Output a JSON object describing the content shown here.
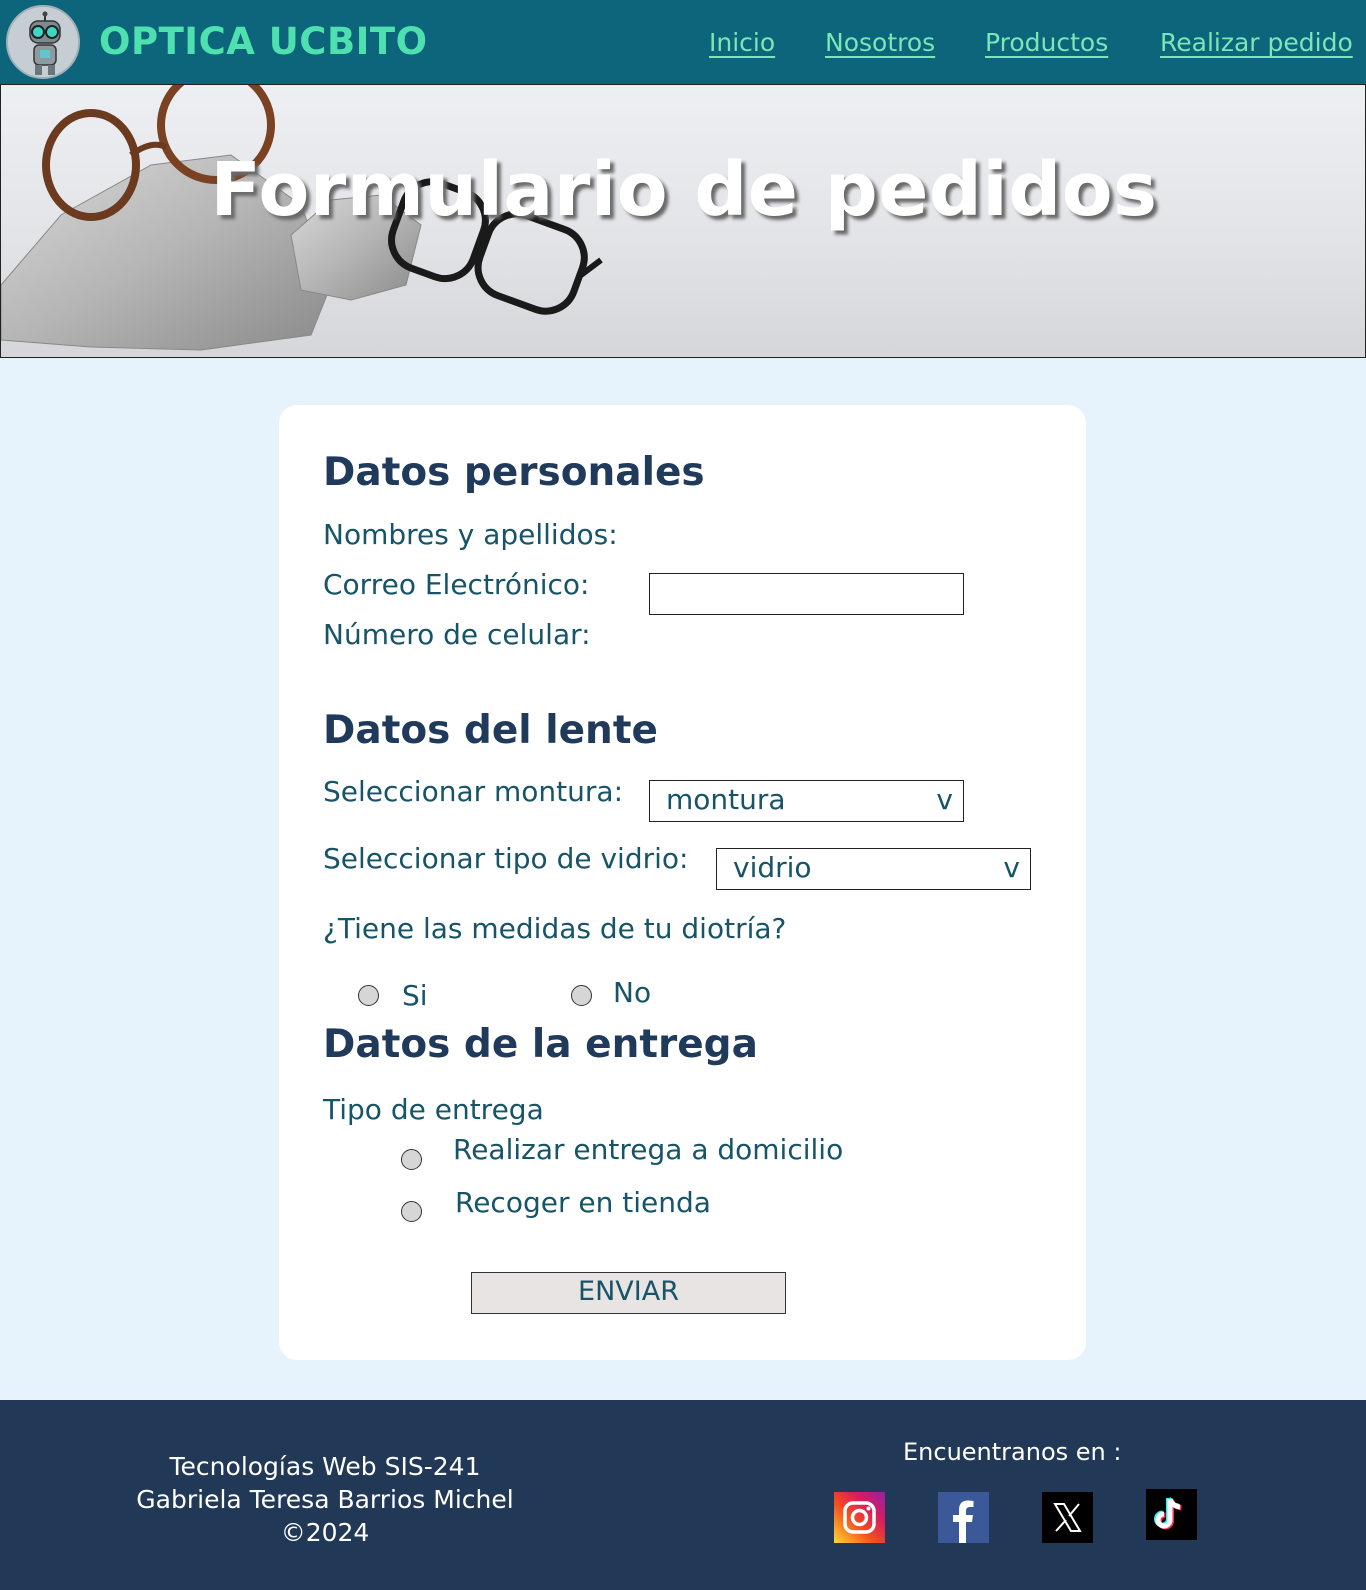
{
  "header": {
    "brand": "OPTICA UCBITO",
    "nav": [
      "Inicio",
      "Nosotros",
      "Productos",
      "Realizar pedido"
    ]
  },
  "hero": {
    "title": "Formulario de pedidos"
  },
  "form": {
    "personal": {
      "heading": "Datos personales",
      "name_label": "Nombres y apellidos:",
      "email_label": "Correo Electrónico:",
      "phone_label": "Número de celular:"
    },
    "lens": {
      "heading": "Datos del lente",
      "frame_label": "Seleccionar montura:",
      "frame_value": "montura",
      "glass_label": "Seleccionar tipo de vidrio:",
      "glass_value": "vidrio",
      "select_arrow": "v",
      "diopter_question": "¿Tiene las medidas de tu diotría?",
      "yes": "Si",
      "no": "No"
    },
    "delivery": {
      "heading": "Datos de la entrega",
      "type_label": "Tipo de entrega",
      "home": "Realizar entrega a domicilio",
      "pickup": "Recoger en tienda"
    },
    "submit": "ENVIAR"
  },
  "footer": {
    "course": "Tecnologías Web SIS-241",
    "author": "Gabriela Teresa Barrios Michel",
    "copyright": "©2024",
    "find_us": "Encuentranos en :",
    "social": [
      "instagram-icon",
      "facebook-icon",
      "x-icon",
      "tiktok-icon"
    ]
  }
}
